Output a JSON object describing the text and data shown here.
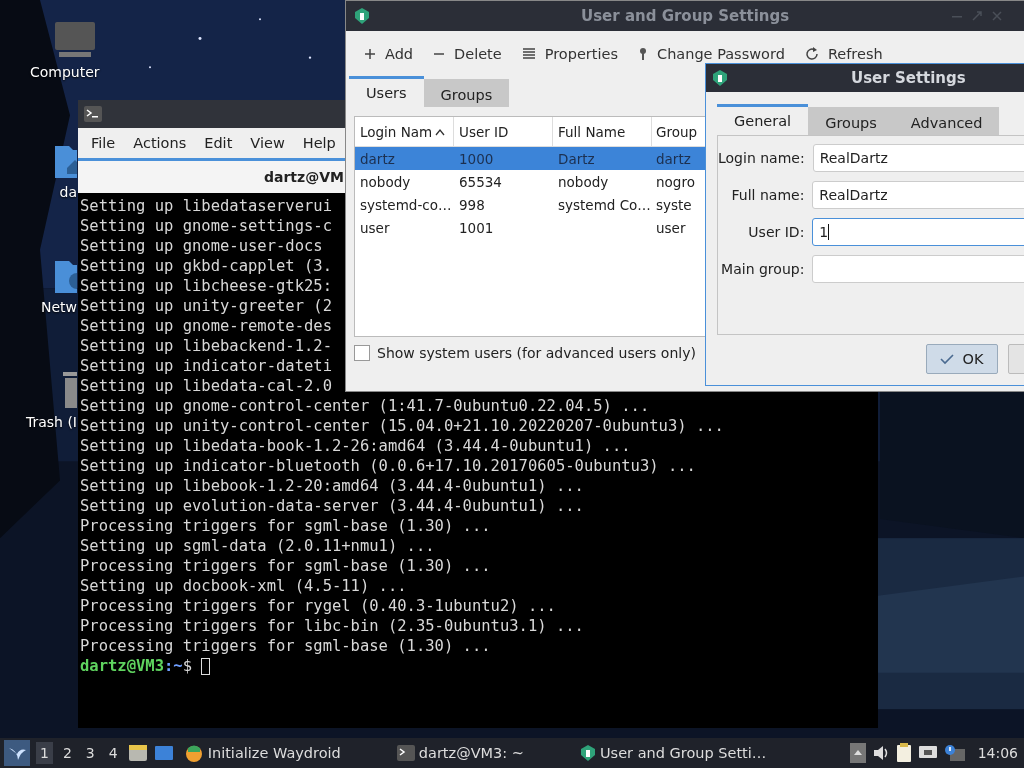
{
  "desktop": {
    "icons": [
      {
        "label": "Computer",
        "kind": "computer"
      },
      {
        "label": "da",
        "kind": "home"
      },
      {
        "label": "Netw",
        "kind": "network"
      },
      {
        "label": "Trash (I",
        "kind": "trash"
      }
    ]
  },
  "terminal": {
    "menu": [
      "File",
      "Actions",
      "Edit",
      "View",
      "Help"
    ],
    "tab_title": "dartz@VM",
    "lines": [
      "Setting up libedataserverui",
      "Setting up gnome-settings-c",
      "Setting up gnome-user-docs",
      "Setting up gkbd-capplet (3.",
      "Setting up libcheese-gtk25:",
      "Setting up unity-greeter (2",
      "Setting up gnome-remote-des",
      "Setting up libebackend-1.2-",
      "Setting up indicator-dateti",
      "Setting up libedata-cal-2.0",
      "Setting up gnome-control-center (1:41.7-0ubuntu0.22.04.5) ...",
      "Setting up unity-control-center (15.04.0+21.10.20220207-0ubuntu3) ...",
      "Setting up libedata-book-1.2-26:amd64 (3.44.4-0ubuntu1) ...",
      "Setting up indicator-bluetooth (0.0.6+17.10.20170605-0ubuntu3) ...",
      "Setting up libebook-1.2-20:amd64 (3.44.4-0ubuntu1) ...",
      "Setting up evolution-data-server (3.44.4-0ubuntu1) ...",
      "Processing triggers for sgml-base (1.30) ...",
      "Setting up sgml-data (2.0.11+nmu1) ...",
      "Processing triggers for sgml-base (1.30) ...",
      "Setting up docbook-xml (4.5-11) ...",
      "Processing triggers for rygel (0.40.3-1ubuntu2) ...",
      "Processing triggers for libc-bin (2.35-0ubuntu3.1) ...",
      "Processing triggers for sgml-base (1.30) ..."
    ],
    "prompt": {
      "user_host": "dartz@VM3",
      "path": ":~",
      "symbol": "$"
    }
  },
  "users_window": {
    "title": "User and Group Settings",
    "toolbar": [
      {
        "label": "Add",
        "kind": "add"
      },
      {
        "label": "Delete",
        "kind": "delete"
      },
      {
        "label": "Properties",
        "kind": "properties"
      },
      {
        "label": "Change Password",
        "kind": "password"
      },
      {
        "label": "Refresh",
        "kind": "refresh"
      }
    ],
    "tabs": [
      {
        "label": "Users",
        "selected": true
      },
      {
        "label": "Groups",
        "selected": false
      }
    ],
    "table": {
      "columns": [
        {
          "label": "Login Nam",
          "sorted": true
        },
        {
          "label": "User ID",
          "sorted": false
        },
        {
          "label": "Full Name",
          "sorted": false
        },
        {
          "label": "Group",
          "sorted": false
        }
      ],
      "rows": [
        {
          "cells": [
            "dartz",
            "1000",
            "Dartz",
            "dartz"
          ],
          "selected": true
        },
        {
          "cells": [
            "nobody",
            "65534",
            "nobody",
            "nogro"
          ],
          "selected": false
        },
        {
          "cells": [
            "systemd-co…",
            "998",
            "systemd Co…",
            "syste"
          ],
          "selected": false
        },
        {
          "cells": [
            "user",
            "1001",
            "",
            "user"
          ],
          "selected": false
        }
      ]
    },
    "show_system_users": {
      "label": "Show system users (for advanced users only)",
      "checked": false
    }
  },
  "dialog": {
    "title": "User Settings",
    "tabs": [
      {
        "label": "General",
        "selected": true
      },
      {
        "label": "Groups",
        "selected": false
      },
      {
        "label": "Advanced",
        "selected": false
      }
    ],
    "fields": [
      {
        "label": "Login name:",
        "value": "RealDartz",
        "focused": false
      },
      {
        "label": "Full name:",
        "value": "RealDartz",
        "focused": false
      },
      {
        "label": "User ID:",
        "value": "1",
        "focused": true
      },
      {
        "label": "Main group:",
        "focused": false
      }
    ],
    "ok": "OK"
  },
  "taskbar": {
    "workspaces": [
      {
        "label": "1",
        "selected": true
      },
      {
        "label": "2",
        "selected": false
      },
      {
        "label": "3",
        "selected": false
      },
      {
        "label": "4",
        "selected": false
      }
    ],
    "tasks": [
      {
        "label": "Initialize Waydroid",
        "kind": "waydroid"
      },
      {
        "label": "dartz@VM3: ~",
        "kind": "terminal"
      },
      {
        "label": "User and Group Setti…",
        "kind": "users"
      }
    ],
    "clock": "14:06"
  }
}
